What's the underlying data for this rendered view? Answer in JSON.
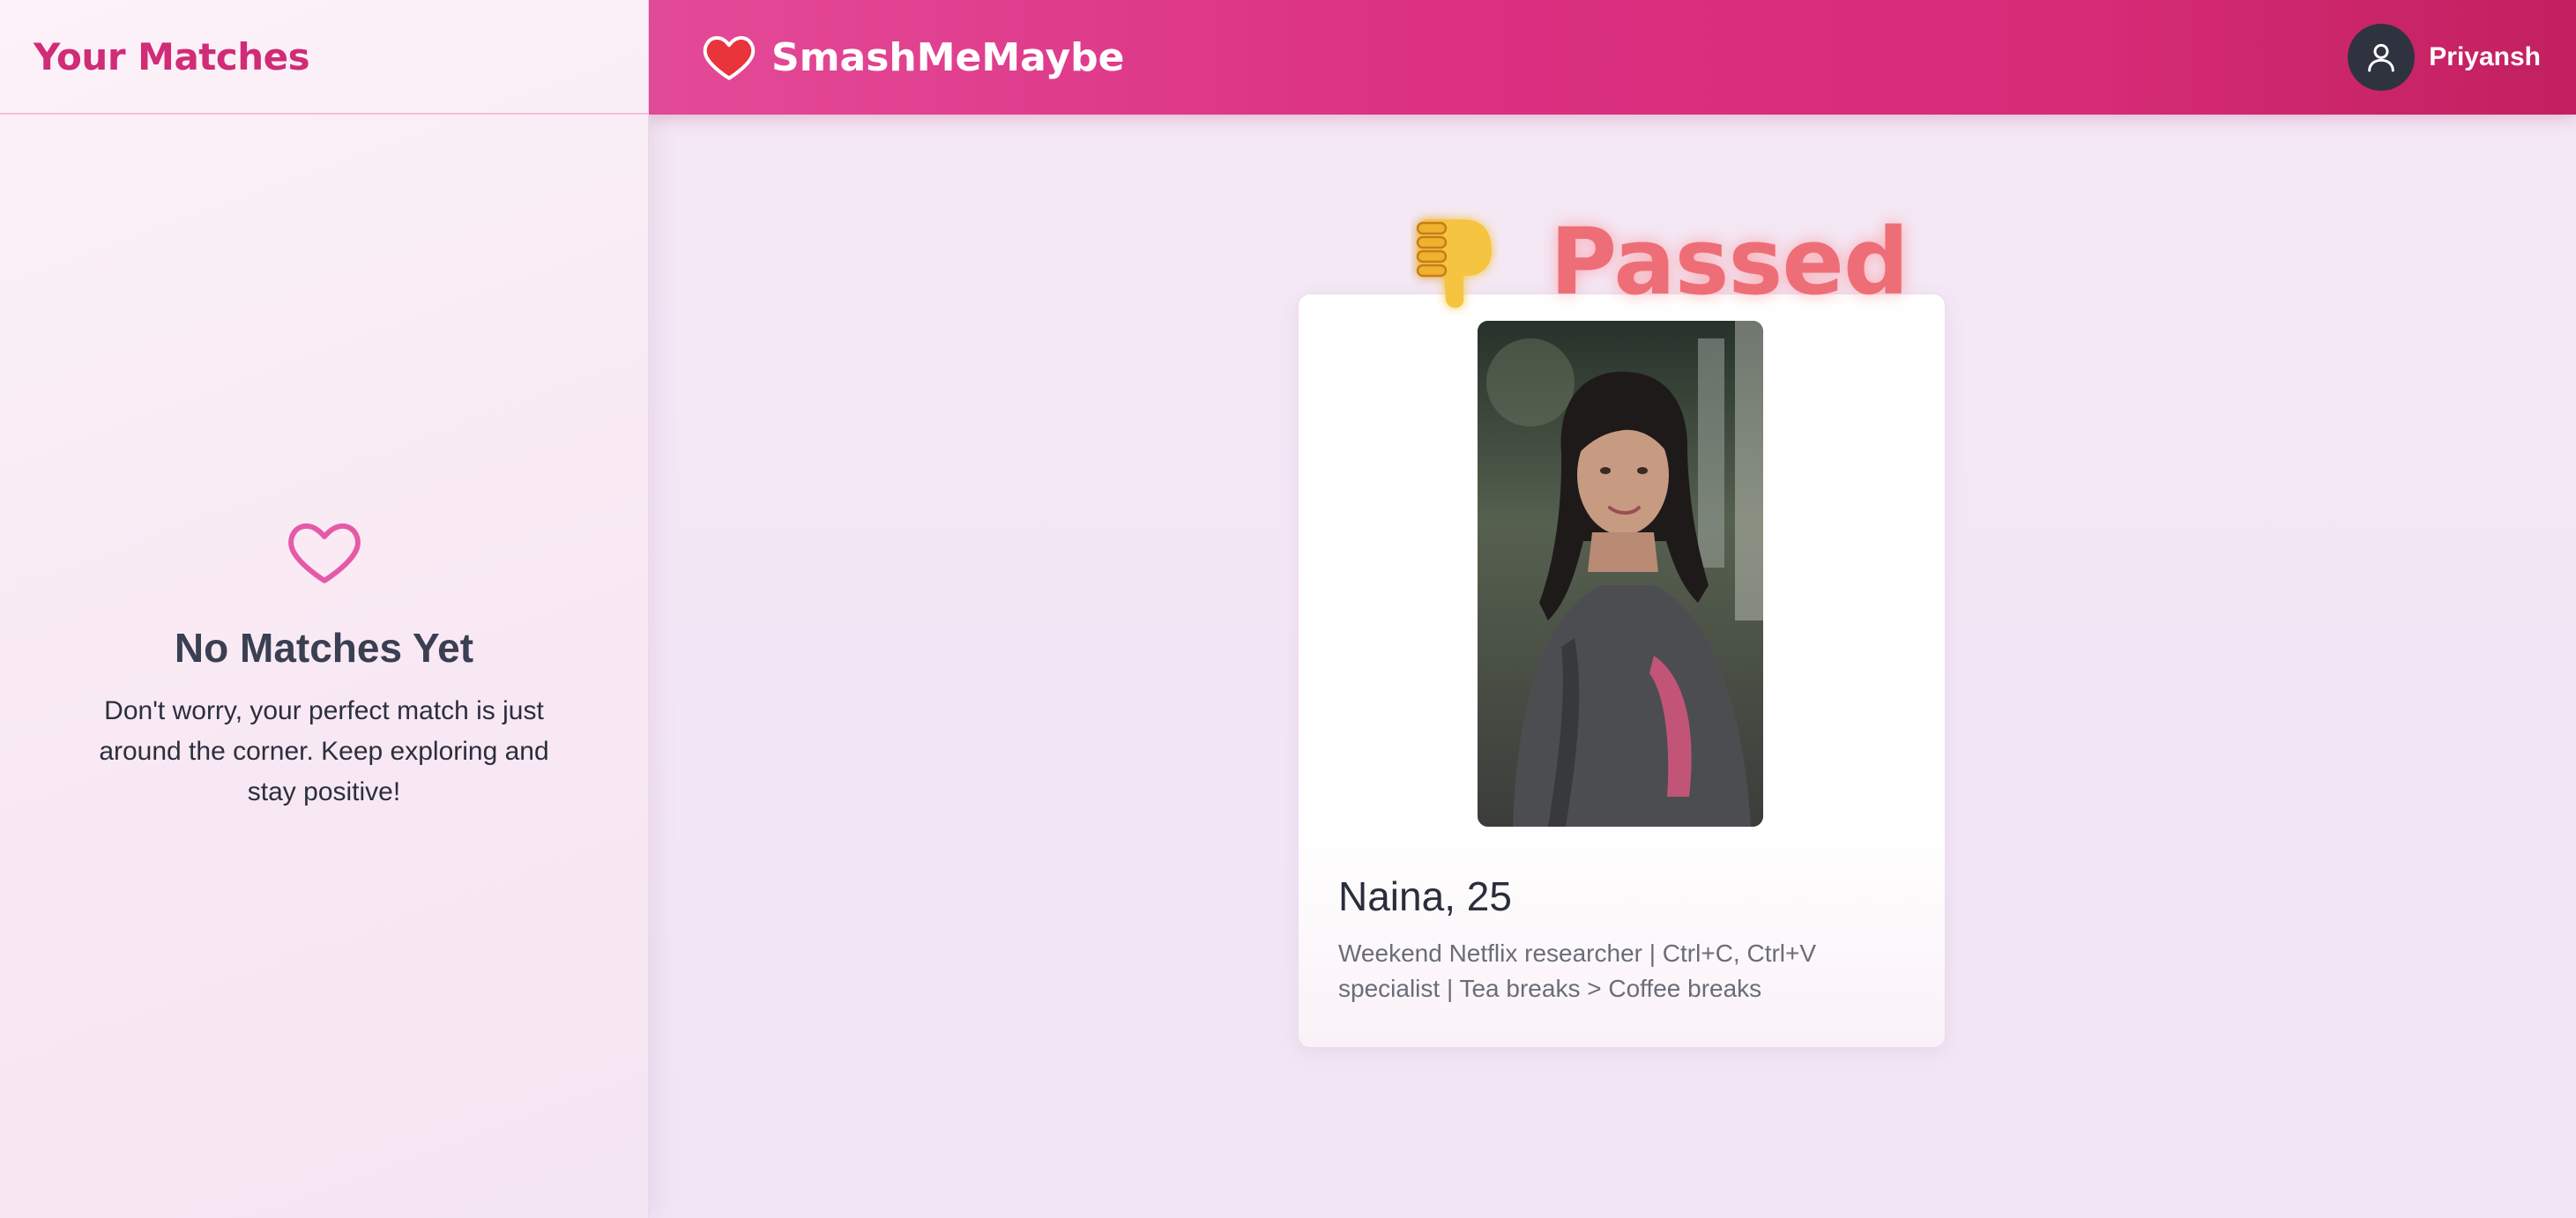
{
  "sidebar": {
    "title": "Your Matches",
    "empty_state": {
      "icon": "heart-outline-icon",
      "title": "No Matches Yet",
      "message": "Don't worry, your perfect match is just around the corner. Keep exploring and stay positive!"
    }
  },
  "header": {
    "brand_name": "SmashMeMaybe",
    "brand_icon": "heart-icon",
    "user": {
      "name": "Priyansh",
      "avatar_icon": "user-icon"
    }
  },
  "card": {
    "status_label": "Passed",
    "status_icon": "thumbs-down-icon",
    "name_age": "Naina, 25",
    "bio": "Weekend Netflix researcher | Ctrl+C, Ctrl+V specialist | Tea breaks > Coffee breaks"
  },
  "colors": {
    "brand_pink": "#dc3183",
    "sidebar_title": "#d02c77",
    "passed_red": "#ee6e78",
    "heart_outline": "#e45aa8"
  }
}
